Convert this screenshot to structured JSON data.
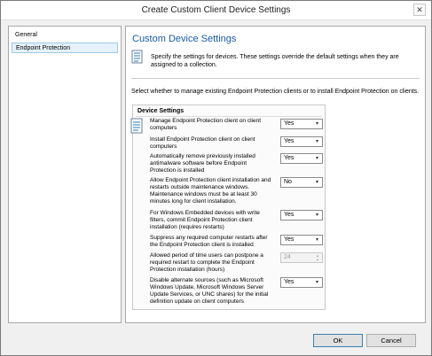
{
  "window": {
    "title": "Create Custom Client Device Settings",
    "close_glyph": "✕"
  },
  "nav": {
    "items": [
      {
        "label": "General"
      },
      {
        "label": "Endpoint Protection"
      }
    ]
  },
  "content": {
    "heading": "Custom Device Settings",
    "intro": "Specify the settings for devices. These settings override the default settings when they are assigned to a collection.",
    "select_desc": "Select whether to manage existing Endpoint Protection clients or to install Endpoint Protection on clients.",
    "group_title": "Device Settings",
    "settings": [
      {
        "label": "Manage Endpoint Protection client on client computers",
        "value": "Yes"
      },
      {
        "label": "Install Endpoint Protection client on client computers",
        "value": "Yes"
      },
      {
        "label": "Automatically remove previously installed antimalware software before Endpoint Protection is installed",
        "value": "Yes"
      },
      {
        "label": "Allow Endpoint Protection client installation and restarts outside maintenance windows. Maintenance windows must be at least 30 minutes long for client installation.",
        "value": "No"
      },
      {
        "label": "For Windows Embedded devices with write filters, commit Endpoint Protection client installation (requires restarts)",
        "value": "Yes"
      },
      {
        "label": "Suppress any required computer restarts after the Endpoint Protection client is installed",
        "value": "Yes"
      },
      {
        "label": "Allowed period of time users can postpone a required restart to complete the Endpoint Protection installation (hours)",
        "value": "24"
      },
      {
        "label": "Disable alternate sources (such as Microsoft Windows Update, Microsoft Windows Server Update Services, or UNC shares) for the initial definition update on client computers",
        "value": "Yes"
      }
    ]
  },
  "buttons": {
    "ok": "OK",
    "cancel": "Cancel"
  },
  "icons": {
    "header": "checklist-icon",
    "settings": "checklist-icon",
    "dropdown_arrow": "▾",
    "spin_up": "▲",
    "spin_down": "▼"
  },
  "colors": {
    "heading": "#1a5aa8",
    "selection": "#e5f1fb"
  }
}
